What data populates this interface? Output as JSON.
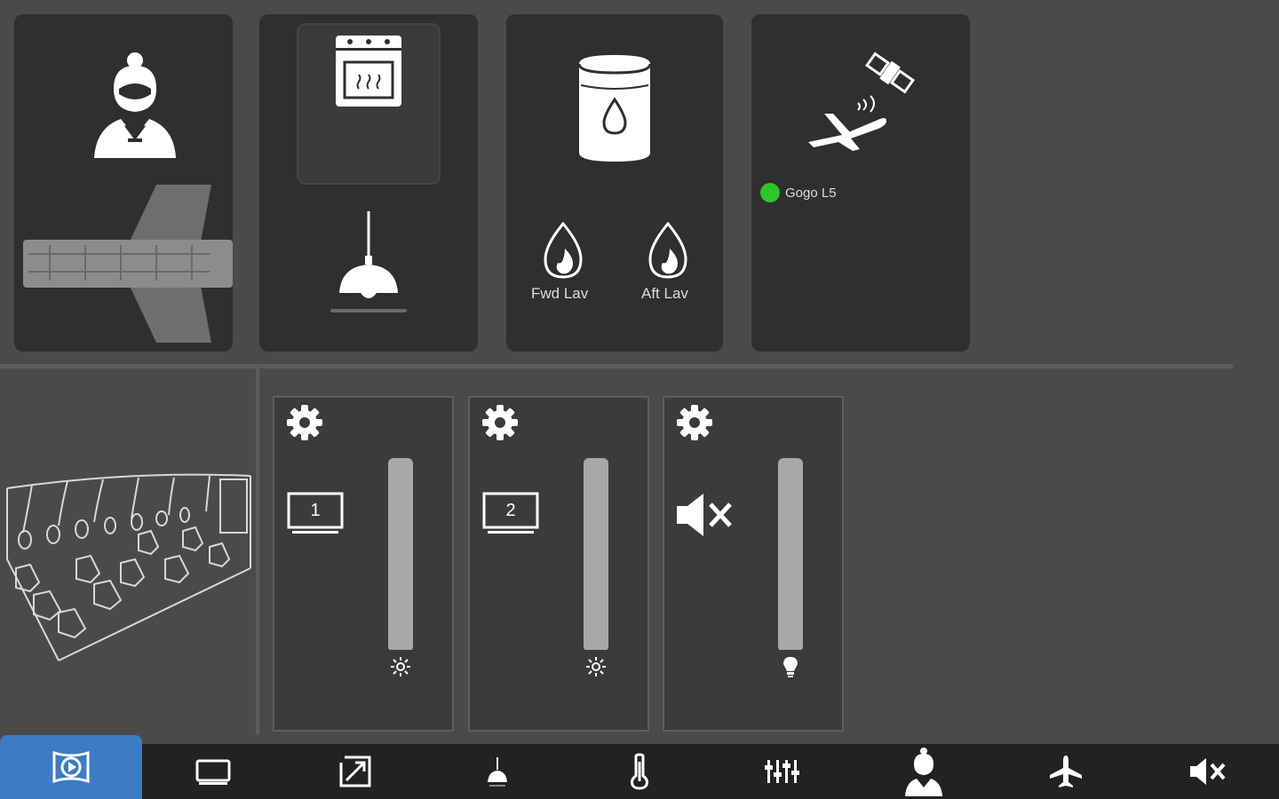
{
  "colors": {
    "status_online": "#2fc52f",
    "active_nav": "#3c7cc4"
  },
  "top_panels": {
    "attendant": {
      "icon": "flight-attendant-icon",
      "map_icon": "aircraft-cabin-map-icon"
    },
    "galley": {
      "oven_icon": "oven-icon",
      "light_icon": "pendant-lamp-icon"
    },
    "water": {
      "tank_icon": "water-tank-icon",
      "fwd_label": "Fwd Lav",
      "aft_label": "Aft Lav"
    },
    "connectivity": {
      "icon": "satellite-aircraft-icon",
      "status_label": "Gogo L5",
      "status": "online"
    }
  },
  "zones": [
    {
      "id": "1",
      "monitor_number": "1",
      "thumb_icon": "brightness-icon",
      "level": 1.0
    },
    {
      "id": "2",
      "monitor_number": "2",
      "thumb_icon": "brightness-icon",
      "level": 1.0
    },
    {
      "id": "3",
      "icon": "mute-icon",
      "thumb_icon": "spotlight-icon",
      "level": 1.0
    }
  ],
  "bottom_nav": [
    {
      "name": "media",
      "icon": "media-play-icon",
      "active": true
    },
    {
      "name": "monitor",
      "icon": "monitor-icon",
      "active": false
    },
    {
      "name": "window-shade",
      "icon": "window-shade-icon",
      "active": false
    },
    {
      "name": "lighting",
      "icon": "lamp-icon",
      "active": false
    },
    {
      "name": "temperature",
      "icon": "thermometer-icon",
      "active": false
    },
    {
      "name": "audio-mixer",
      "icon": "mixer-sliders-icon",
      "active": false
    },
    {
      "name": "attendant",
      "icon": "flight-attendant-icon",
      "active": false
    },
    {
      "name": "flight-info",
      "icon": "airplane-icon",
      "active": false
    },
    {
      "name": "mute",
      "icon": "mute-icon",
      "active": false
    }
  ]
}
